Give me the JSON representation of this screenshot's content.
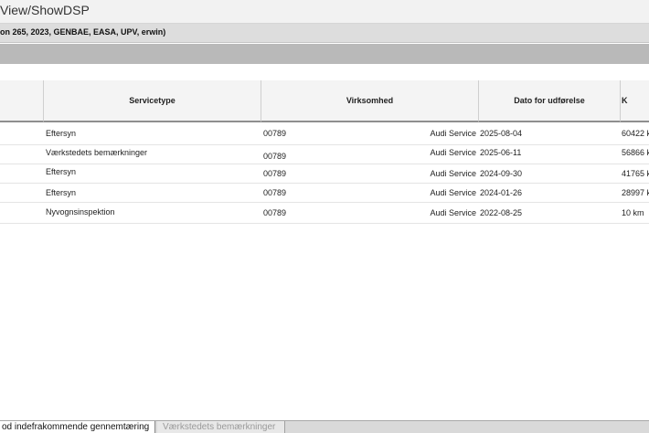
{
  "window": {
    "title": "View/ShowDSP"
  },
  "info": {
    "text": "on 265, 2023, GENBAE, EASA, UPV, erwin)"
  },
  "table": {
    "columns": [
      "",
      "Servicetype",
      "Virksomhed",
      "Dato for udførelse",
      "K"
    ],
    "rows": [
      {
        "servicetype": "Eftersyn",
        "code": "00789",
        "company": "Audi Service",
        "date": "2025-08-04",
        "km": "60422 k"
      },
      {
        "servicetype": "Værkstedets bemærkninger",
        "code": "00789",
        "company": "Audi Service",
        "date": "2025-06-11",
        "km": "56866 k"
      },
      {
        "servicetype": "Eftersyn",
        "code": "00789",
        "company": "Audi Service",
        "date": "2024-09-30",
        "km": "41765 k"
      },
      {
        "servicetype": "Eftersyn",
        "code": "00789",
        "company": "Audi Service",
        "date": "2024-01-26",
        "km": "28997 k"
      },
      {
        "servicetype": "Nyvognsinspektion",
        "code": "00789",
        "company": "Audi Service",
        "date": "2022-08-25",
        "km": "10 km"
      }
    ]
  },
  "tabs": [
    {
      "label": "od indefrakommende gennemtæring",
      "active": true
    },
    {
      "label": "Værkstedets bemærkninger",
      "active": false
    }
  ]
}
